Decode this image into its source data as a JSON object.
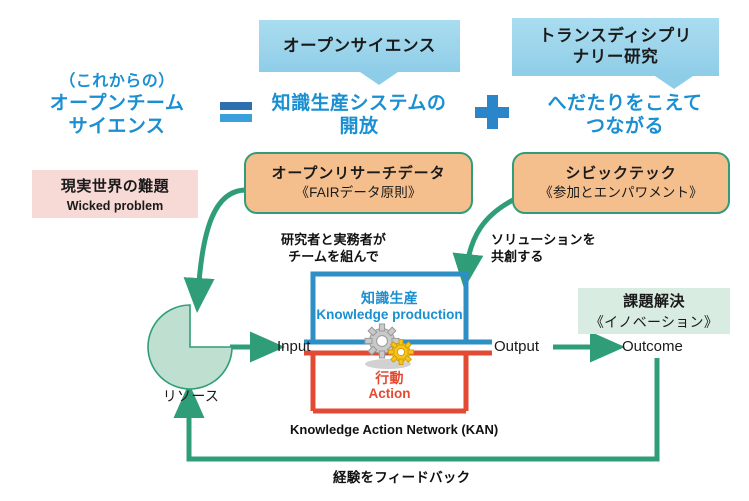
{
  "diagram": {
    "title_left": {
      "line1": "（これからの）",
      "line2": "オープンチーム",
      "line3": "サイエンス"
    },
    "equals_symbol": "=",
    "plus_symbol": "+",
    "title_middle": {
      "line1": "知識生産システムの",
      "line2": "開放"
    },
    "title_right": {
      "line1": "へだたりをこえて",
      "line2": "つながる"
    },
    "callouts": [
      {
        "name": "open-science",
        "line1": "オープンサイエンス"
      },
      {
        "name": "transdisciplinary-research",
        "line1": "トランスディシプリ",
        "line2": "ナリー研究"
      }
    ],
    "orange_boxes": [
      {
        "name": "open-research-data",
        "main": "オープンリサーチデータ",
        "sub": "《FAIRデータ原則》"
      },
      {
        "name": "civic-tech",
        "main": "シビックテック",
        "sub": "《参加とエンパワメント》"
      }
    ],
    "wicked_problem": {
      "main": "現実世界の難題",
      "sub": "Wicked problem"
    },
    "innovation": {
      "main": "課題解決",
      "sub": "《イノベーション》"
    },
    "annotations": {
      "left": {
        "line1": "研究者と実務者が",
        "line2": "チームを組んで"
      },
      "right": {
        "line1": "ソリューションを",
        "line2": "共創する"
      }
    },
    "kan": {
      "knowledge_production_jp": "知識生産",
      "knowledge_production_en": "Knowledge production",
      "action_jp": "行動",
      "action_en": "Action",
      "caption": "Knowledge Action Network (KAN)"
    },
    "nodes": {
      "input": "Input",
      "output": "Output",
      "outcome": "Outcome",
      "resource": "リソース"
    },
    "feedback_label": "経験をフィードバック",
    "icons": {
      "gear_gray": "gear-icon",
      "gear_yellow": "gear-icon"
    },
    "colors": {
      "headline_blue": "#1a8fd1",
      "callout_blue": "#9fd6ec",
      "orange_fill": "#f5bf8d",
      "green_stroke": "#2f9e78",
      "pink_fill": "#f7d9d6",
      "mint_fill": "#d9ece2",
      "kan_blue": "#2e8fc4",
      "kan_red": "#e34a33",
      "resource_fill": "#bfdfd0"
    }
  }
}
